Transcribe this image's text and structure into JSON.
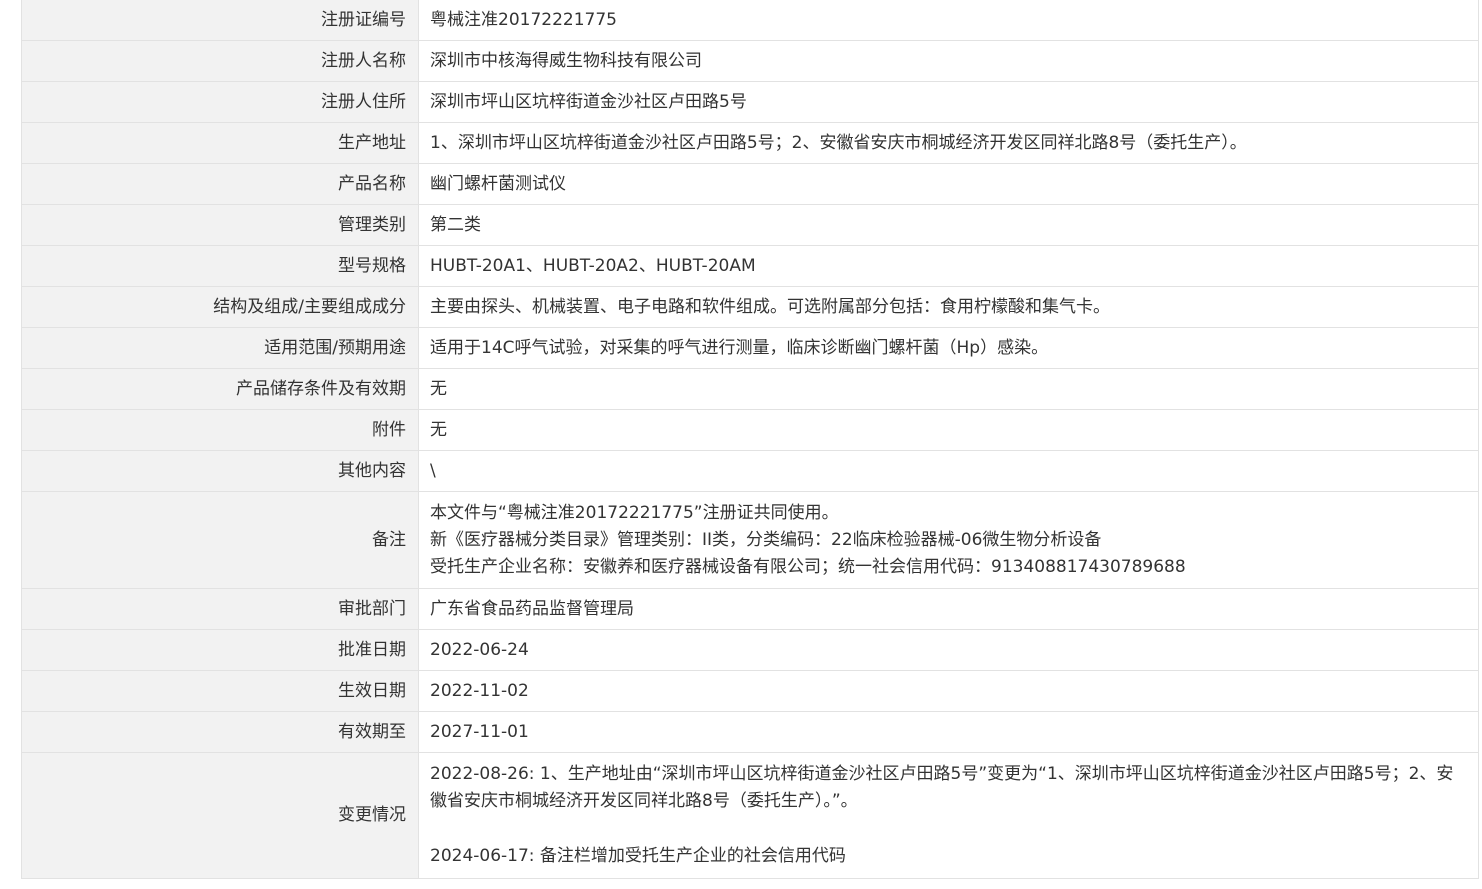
{
  "rows": [
    {
      "label": "注册证编号",
      "value": "粤械注准20172221775"
    },
    {
      "label": "注册人名称",
      "value": "深圳市中核海得威生物科技有限公司"
    },
    {
      "label": "注册人住所",
      "value": "深圳市坪山区坑梓街道金沙社区卢田路5号"
    },
    {
      "label": "生产地址",
      "value": "1、深圳市坪山区坑梓街道金沙社区卢田路5号；2、安徽省安庆市桐城经济开发区同祥北路8号（委托生产）。"
    },
    {
      "label": "产品名称",
      "value": "幽门螺杆菌测试仪"
    },
    {
      "label": "管理类别",
      "value": "第二类"
    },
    {
      "label": "型号规格",
      "value": "HUBT-20A1、HUBT-20A2、HUBT-20AM"
    },
    {
      "label": "结构及组成/主要组成成分",
      "value": "主要由探头、机械装置、电子电路和软件组成。可选附属部分包括：食用柠檬酸和集气卡。"
    },
    {
      "label": "适用范围/预期用途",
      "value": "适用于14C呼气试验，对采集的呼气进行测量，临床诊断幽门螺杆菌（Hp）感染。"
    },
    {
      "label": "产品储存条件及有效期",
      "value": "无"
    },
    {
      "label": "附件",
      "value": "无"
    },
    {
      "label": "其他内容",
      "value": "\\"
    }
  ],
  "remarks": {
    "label": "备注",
    "lines": [
      "本文件与“粤械注准20172221775”注册证共同使用。",
      "新《医疗器械分类目录》管理类别：II类，分类编码：22临床检验器械-06微生物分析设备",
      "受托生产企业名称：安徽养和医疗器械设备有限公司；统一社会信用代码：913408817430789688"
    ]
  },
  "rows_after": [
    {
      "label": "审批部门",
      "value": "广东省食品药品监督管理局"
    },
    {
      "label": "批准日期",
      "value": "2022-06-24"
    },
    {
      "label": "生效日期",
      "value": "2022-11-02"
    },
    {
      "label": "有效期至",
      "value": "2027-11-01"
    }
  ],
  "changes": {
    "label": "变更情况",
    "entries": [
      "2022-08-26: 1、生产地址由“深圳市坪山区坑梓街道金沙社区卢田路5号”变更为“1、深圳市坪山区坑梓街道金沙社区卢田路5号；2、安徽省安庆市桐城经济开发区同祥北路8号（委托生产）。”。",
      "2024-06-17: 备注栏增加受托生产企业的社会信用代码"
    ]
  }
}
